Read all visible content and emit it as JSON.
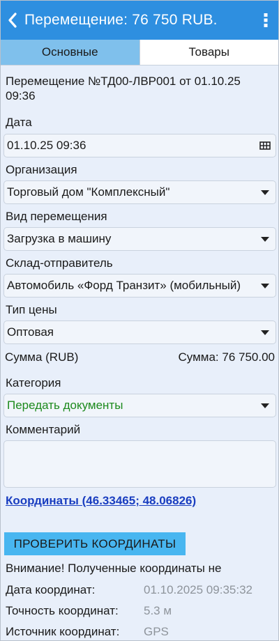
{
  "appbar": {
    "title": "Перемещение: 76 750 RUB.",
    "back_icon": "chevron-left-icon",
    "menu_icon": "more-vertical-icon",
    "color": "#2e8fe0"
  },
  "tabs": [
    {
      "label": "Основные",
      "active": true
    },
    {
      "label": "Товары",
      "active": false
    }
  ],
  "heading": "Перемещение №ТД00-ЛВР001 от 01.10.25 09:36",
  "fields": {
    "date": {
      "label": "Дата",
      "value": "01.10.25 09:36",
      "icon": "calendar-grid-icon"
    },
    "organization": {
      "label": "Организация",
      "value": "Торговый дом \"Комплексный\""
    },
    "transfer_type": {
      "label": "Вид перемещения",
      "value": "Загрузка в машину"
    },
    "sender_warehouse": {
      "label": "Склад-отправитель",
      "value": "Автомобиль «Форд Транзит» (мобильный)"
    },
    "price_type": {
      "label": "Тип цены",
      "value": "Оптовая"
    },
    "category": {
      "label": "Категория",
      "value": "Передать документы",
      "value_color": "#1d8a1d"
    },
    "comment": {
      "label": "Комментарий",
      "value": ""
    }
  },
  "sum": {
    "label": "Сумма (RUB)",
    "value": "Сумма: 76 750.00"
  },
  "coordinates_link": "Координаты (46.33465; 48.06826)",
  "check_button": "ПРОВЕРИТЬ КООРДИНАТЫ",
  "warning": "Внимание! Полученные координаты не",
  "coord_info": [
    {
      "label": "Дата координат:",
      "value": "01.10.2025 09:35:32"
    },
    {
      "label": "Точность координат:",
      "value": "5.3 м"
    },
    {
      "label": "Источник координат:",
      "value": "GPS"
    }
  ]
}
